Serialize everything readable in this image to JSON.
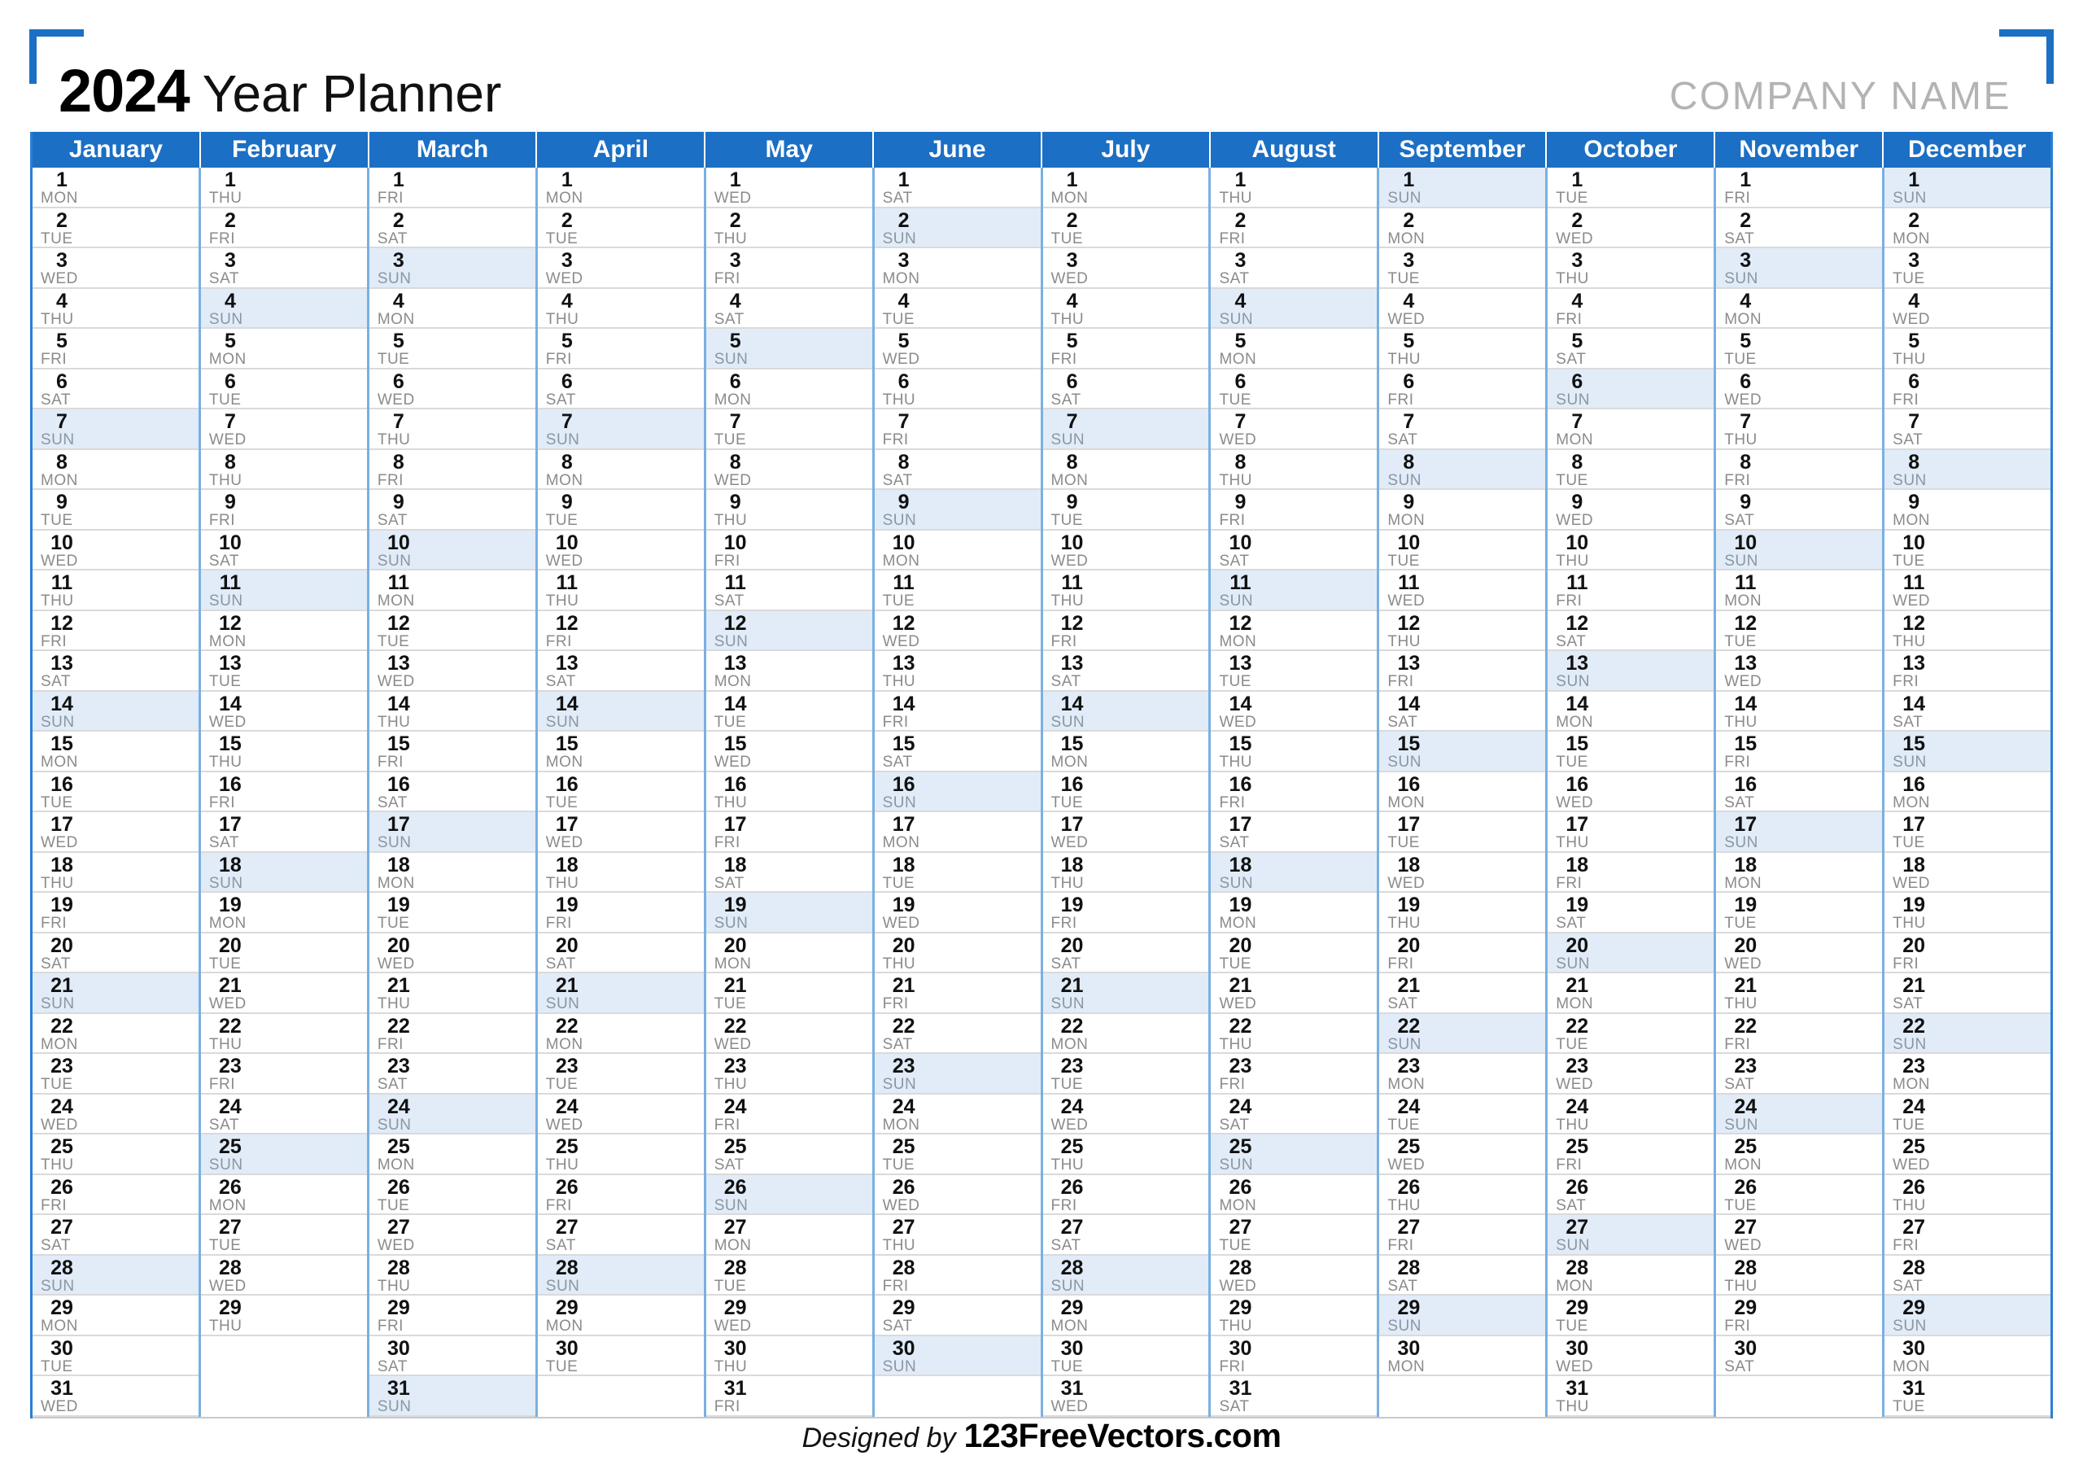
{
  "header": {
    "title_year": "2024",
    "title_rest": "Year Planner",
    "company_name": "COMPANY NAME"
  },
  "footer": {
    "designed_by": "Designed by",
    "brand": "123FreeVectors.com"
  },
  "colors": {
    "header_blue": "#1b6fc4",
    "bracket_blue": "#1b6fc4",
    "column_separator": "#7ab0e2",
    "sunday_highlight": "#e1ecf8",
    "row_line": "#dadada",
    "company_gray": "#b3b3b3",
    "day_abbr_gray": "#8b8b8b"
  },
  "calendar": {
    "year": 2024,
    "weekday_abbrs": [
      "MON",
      "TUE",
      "WED",
      "THU",
      "FRI",
      "SAT",
      "SUN"
    ],
    "highlight_weekday": "SUN",
    "max_rows": 31,
    "months": [
      {
        "name": "January",
        "days": 31,
        "first_weekday": "MON"
      },
      {
        "name": "February",
        "days": 29,
        "first_weekday": "THU"
      },
      {
        "name": "March",
        "days": 31,
        "first_weekday": "FRI"
      },
      {
        "name": "April",
        "days": 30,
        "first_weekday": "MON"
      },
      {
        "name": "May",
        "days": 31,
        "first_weekday": "WED"
      },
      {
        "name": "June",
        "days": 30,
        "first_weekday": "SAT"
      },
      {
        "name": "July",
        "days": 31,
        "first_weekday": "MON"
      },
      {
        "name": "August",
        "days": 31,
        "first_weekday": "THU"
      },
      {
        "name": "September",
        "days": 30,
        "first_weekday": "SUN"
      },
      {
        "name": "October",
        "days": 31,
        "first_weekday": "TUE"
      },
      {
        "name": "November",
        "days": 30,
        "first_weekday": "FRI"
      },
      {
        "name": "December",
        "days": 31,
        "first_weekday": "SUN"
      }
    ]
  }
}
